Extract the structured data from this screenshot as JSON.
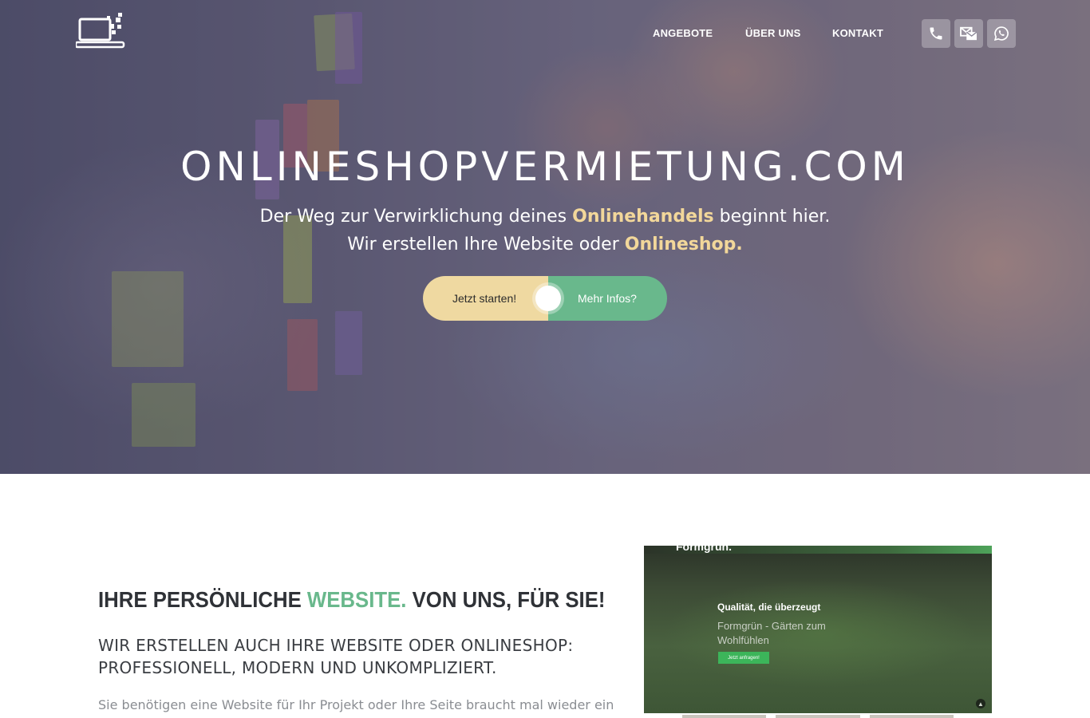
{
  "nav": {
    "items": [
      {
        "label": "ANGEBOTE"
      },
      {
        "label": "ÜBER UNS"
      },
      {
        "label": "KONTAKT"
      }
    ],
    "icons": [
      "phone-icon",
      "email-icon",
      "whatsapp-icon"
    ]
  },
  "hero": {
    "title": "ONLINESHOPVERMIETUNG.COM",
    "line1_pre": "Der Weg zur Verwirklichung deines ",
    "line1_highlight": "Onlinehandels",
    "line1_post": " beginnt hier.",
    "line2_pre": "Wir erstellen Ihre Website oder ",
    "line2_highlight": "Onlineshop.",
    "cta_primary": "Jetzt starten!",
    "cta_secondary": "Mehr Infos?"
  },
  "section": {
    "title_pre": "IHRE PERSÖNLICHE ",
    "title_highlight": "WEBSITE.",
    "title_post": " VON UNS, FÜR SIE!",
    "subtitle": "WIR ERSTELLEN AUCH IHRE WEBSITE ODER ONLINESHOP: PROFESSIONELL, MODERN UND UNKOMPLIZIERT.",
    "body": "Sie benötigen eine Website für Ihr Projekt oder Ihre Seite braucht mal wieder ein"
  },
  "preview": {
    "brand": "Formgrün.",
    "heading": "Qualität, die überzeugt",
    "text": "Formgrün - Gärten zum Wohlfühlen",
    "button": "Jetzt anfragen!"
  },
  "colors": {
    "accent_gold": "#efd9a1",
    "accent_green": "#69b88c",
    "title_dark": "#2f3237"
  }
}
